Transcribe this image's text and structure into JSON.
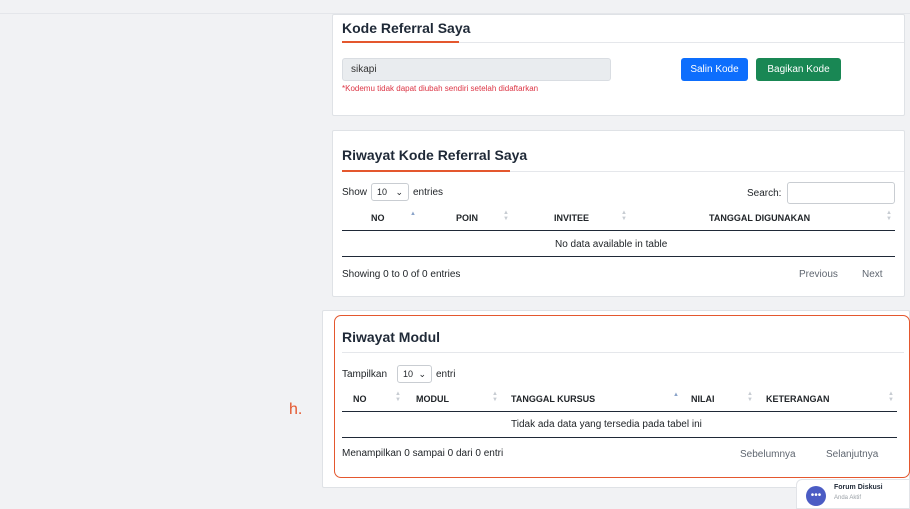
{
  "marker": "h.",
  "referral": {
    "title": "Kode Referral Saya",
    "code_value": "sikapi",
    "note": "*Kodemu tidak dapat diubah sendiri setelah didaftarkan",
    "copy_label": "Salin Kode",
    "share_label": "Bagikan Kode",
    "colors": {
      "copy": "#0d6efd",
      "share": "#198754",
      "note": "#dc3545",
      "accent": "#e4572e"
    }
  },
  "history": {
    "title": "Riwayat Kode Referral Saya",
    "show_label": "Show",
    "entries_value": "10",
    "entries_label": "entries",
    "search_label": "Search:",
    "columns": [
      "NO",
      "POIN",
      "INVITEE",
      "TANGGAL DIGUNAKAN"
    ],
    "empty_message": "No data available in table",
    "info": "Showing 0 to 0 of 0 entries",
    "previous_label": "Previous",
    "next_label": "Next"
  },
  "modules": {
    "title": "Riwayat Modul",
    "show_label": "Tampilkan",
    "entries_value": "10",
    "entries_label": "entri",
    "columns": [
      "NO",
      "MODUL",
      "TANGGAL KURSUS",
      "NILAI",
      "KETERANGAN"
    ],
    "empty_message": "Tidak ada data yang tersedia pada tabel ini",
    "info": "Menampilkan 0 sampai 0 dari 0 entri",
    "previous_label": "Sebelumnya",
    "next_label": "Selanjutnya"
  },
  "chat": {
    "title": "Forum Diskusi",
    "status": "Anda Aktif",
    "icon": "chat-dots-icon"
  }
}
